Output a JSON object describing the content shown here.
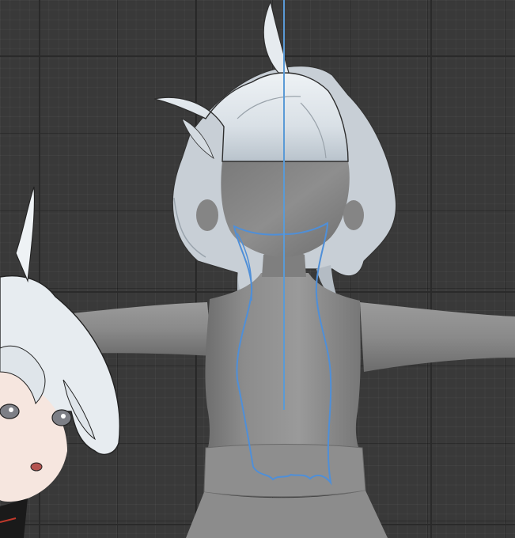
{
  "viewport": {
    "background": "#393939",
    "grid_line_color": "#2a2a2a",
    "center_axis_color": "#5a9ad6"
  },
  "model": {
    "body_color": "#8a8a8a",
    "hair_color": "#dfe5ea",
    "guide_stroke_color": "#4f8fd8"
  },
  "reference_image": {
    "subject": "anime-girl-reference-sketch"
  }
}
